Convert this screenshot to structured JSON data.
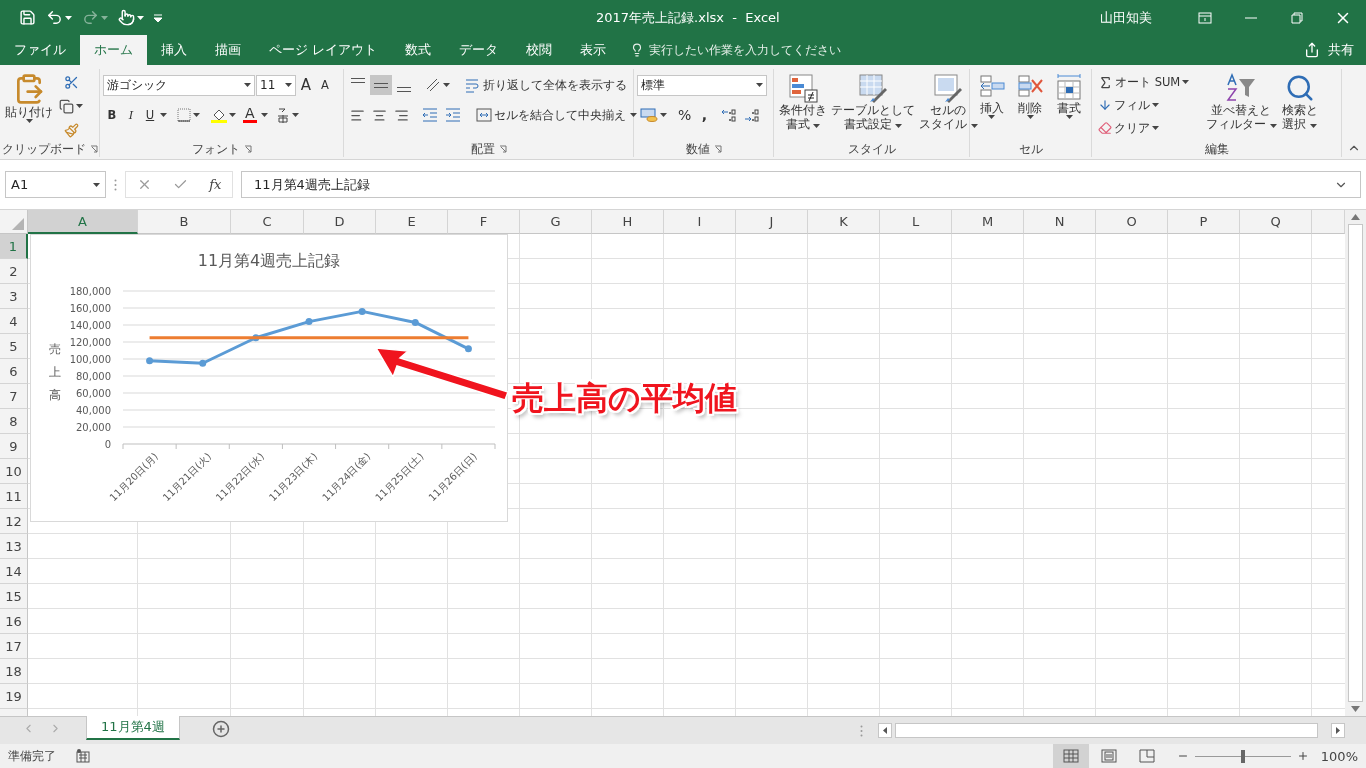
{
  "window": {
    "title": "2017年売上記録.xlsx  -  Excel",
    "user": "山田知美"
  },
  "menu_tabs": [
    {
      "label": "ファイル",
      "selected": false
    },
    {
      "label": "ホーム",
      "selected": true
    },
    {
      "label": "挿入",
      "selected": false
    },
    {
      "label": "描画",
      "selected": false
    },
    {
      "label": "ページ レイアウト",
      "selected": false
    },
    {
      "label": "数式",
      "selected": false
    },
    {
      "label": "データ",
      "selected": false
    },
    {
      "label": "校閲",
      "selected": false
    },
    {
      "label": "表示",
      "selected": false
    }
  ],
  "tell_me": {
    "placeholder": "実行したい作業を入力してください"
  },
  "share": "共有",
  "ribbon": {
    "clipboard": {
      "label": "クリップボード",
      "paste": "貼り付け"
    },
    "font": {
      "label": "フォント",
      "font_name": "游ゴシック",
      "font_size": "11",
      "grow": "A",
      "shrink": "A",
      "bold": "B",
      "italic": "I",
      "underline": "U",
      "font_color": "A"
    },
    "alignment": {
      "label": "配置",
      "vertical": [
        {
          "kind": "top",
          "selected": false
        },
        {
          "kind": "middle",
          "selected": true
        },
        {
          "kind": "bottom",
          "selected": false
        }
      ],
      "wrap": "折り返して全体を表示する",
      "merge": "セルを結合して中央揃え"
    },
    "number": {
      "label": "数値",
      "format": "標準",
      "percent": "%",
      "comma": ","
    },
    "styles": {
      "label": "スタイル",
      "buttons": [
        {
          "kind": "conditional",
          "lines": [
            "条件付き",
            "書式"
          ]
        },
        {
          "kind": "table",
          "lines": [
            "テーブルとして",
            "書式設定"
          ]
        },
        {
          "kind": "cellstyle",
          "lines": [
            "セルの",
            "スタイル"
          ]
        }
      ]
    },
    "cells": {
      "label": "セル",
      "buttons": [
        {
          "kind": "insert",
          "label": "挿入"
        },
        {
          "kind": "delete",
          "label": "削除"
        },
        {
          "kind": "format",
          "label": "書式"
        }
      ]
    },
    "editing": {
      "label": "編集",
      "autosum": "オート SUM",
      "fill": "フィル",
      "clear": "クリア",
      "sort": [
        "並べ替えと",
        "フィルター"
      ],
      "find": [
        "検索と",
        "選択"
      ]
    }
  },
  "formula_bar": {
    "name_box": "A1",
    "fx": "fx",
    "value": "11月第4週売上記録"
  },
  "columns": [
    {
      "label": "A",
      "selected": true
    },
    {
      "label": "B",
      "selected": false
    },
    {
      "label": "C",
      "selected": false
    },
    {
      "label": "D",
      "selected": false
    },
    {
      "label": "E",
      "selected": false
    },
    {
      "label": "F",
      "selected": false
    },
    {
      "label": "G",
      "selected": false
    },
    {
      "label": "H",
      "selected": false
    },
    {
      "label": "I",
      "selected": false
    },
    {
      "label": "J",
      "selected": false
    },
    {
      "label": "K",
      "selected": false
    },
    {
      "label": "L",
      "selected": false
    },
    {
      "label": "M",
      "selected": false
    },
    {
      "label": "N",
      "selected": false
    },
    {
      "label": "O",
      "selected": false
    },
    {
      "label": "P",
      "selected": false
    },
    {
      "label": "Q",
      "selected": false
    }
  ],
  "rows": [
    {
      "label": "1",
      "selected": true
    },
    {
      "label": "2",
      "selected": false
    },
    {
      "label": "3",
      "selected": false
    },
    {
      "label": "4",
      "selected": false
    },
    {
      "label": "5",
      "selected": false
    },
    {
      "label": "6",
      "selected": false
    },
    {
      "label": "7",
      "selected": false
    },
    {
      "label": "8",
      "selected": false
    },
    {
      "label": "9",
      "selected": false
    },
    {
      "label": "10",
      "selected": false
    },
    {
      "label": "11",
      "selected": false
    },
    {
      "label": "12",
      "selected": false
    },
    {
      "label": "13",
      "selected": false
    },
    {
      "label": "14",
      "selected": false
    },
    {
      "label": "15",
      "selected": false
    },
    {
      "label": "16",
      "selected": false
    },
    {
      "label": "17",
      "selected": false
    },
    {
      "label": "18",
      "selected": false
    },
    {
      "label": "19",
      "selected": false
    }
  ],
  "chart": {
    "chart_data": {
      "type": "line",
      "title": "11月第4週売上記録",
      "ylabel": "売上高",
      "grid": true,
      "categories": [
        "11月20日(月)",
        "11月21日(火)",
        "11月22日(水)",
        "11月23日(木)",
        "11月24日(金)",
        "11月25日(土)",
        "11月26日(日)"
      ],
      "series": [
        {
          "color": "#5b9bd5",
          "marker": "circle",
          "values": [
            98000,
            95000,
            125000,
            144000,
            156000,
            143000,
            112000
          ]
        },
        {
          "color": "#ed7d31",
          "values": [
            125000,
            125000,
            125000,
            125000,
            125000,
            125000,
            125000
          ]
        }
      ],
      "ylim": [
        0,
        180000
      ],
      "yticks": [
        {
          "value": 0,
          "label": "0"
        },
        {
          "value": 20000,
          "label": "20,000"
        },
        {
          "value": 40000,
          "label": "40,000"
        },
        {
          "value": 60000,
          "label": "60,000"
        },
        {
          "value": 80000,
          "label": "80,000"
        },
        {
          "value": 100000,
          "label": "100,000"
        },
        {
          "value": 120000,
          "label": "120,000"
        },
        {
          "value": 140000,
          "label": "140,000"
        },
        {
          "value": 160000,
          "label": "160,000"
        },
        {
          "value": 180000,
          "label": "180,000"
        }
      ]
    }
  },
  "annotation": {
    "text": "売上高の平均値"
  },
  "sheet_tabs": [
    {
      "label": "11月第4週",
      "selected": true
    }
  ],
  "status": {
    "text": "準備完了",
    "views": [
      {
        "kind": "normal",
        "selected": true
      },
      {
        "kind": "page_layout",
        "selected": false
      },
      {
        "kind": "page_break",
        "selected": false
      }
    ],
    "zoom_slider": {
      "level": 0.5
    },
    "zoom": "100%"
  }
}
